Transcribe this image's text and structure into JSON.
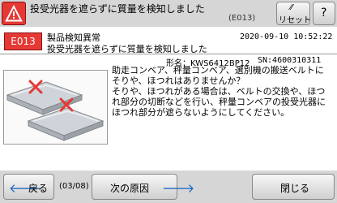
{
  "header": {
    "title": "投受光器を遮らずに質量を検知しました",
    "code": "(E013)",
    "reset_label": "リセット",
    "help_label": "?"
  },
  "error": {
    "code": "E013",
    "line1": "製品検知異常",
    "line2": "投受光器を遮らずに質量を検知しました",
    "datetime": "2020-09-10   10:52:22",
    "model": "形名：KWS6412BP12",
    "serial": "SN:4600310311"
  },
  "description": [
    "助走コンベア、秤量コンベア、選別機の搬送ベルトに",
    "そりや、ほつれはありませんか？",
    "そりや、ほつれがある場合は、ベルトの交換や、ほつ",
    "れ部分の切断などを行い、秤量コンベアの投受光器に",
    "ほつれ部分が遮らないようにしてください。"
  ],
  "footer": {
    "back_label": "戻る",
    "page": "(03/08)",
    "next_label": "次の原因",
    "close_label": "閉じる"
  },
  "colors": {
    "alert_red": "#e53935",
    "bar_gray": "#d6d6d6",
    "arrow_blue": "#1565c0"
  }
}
